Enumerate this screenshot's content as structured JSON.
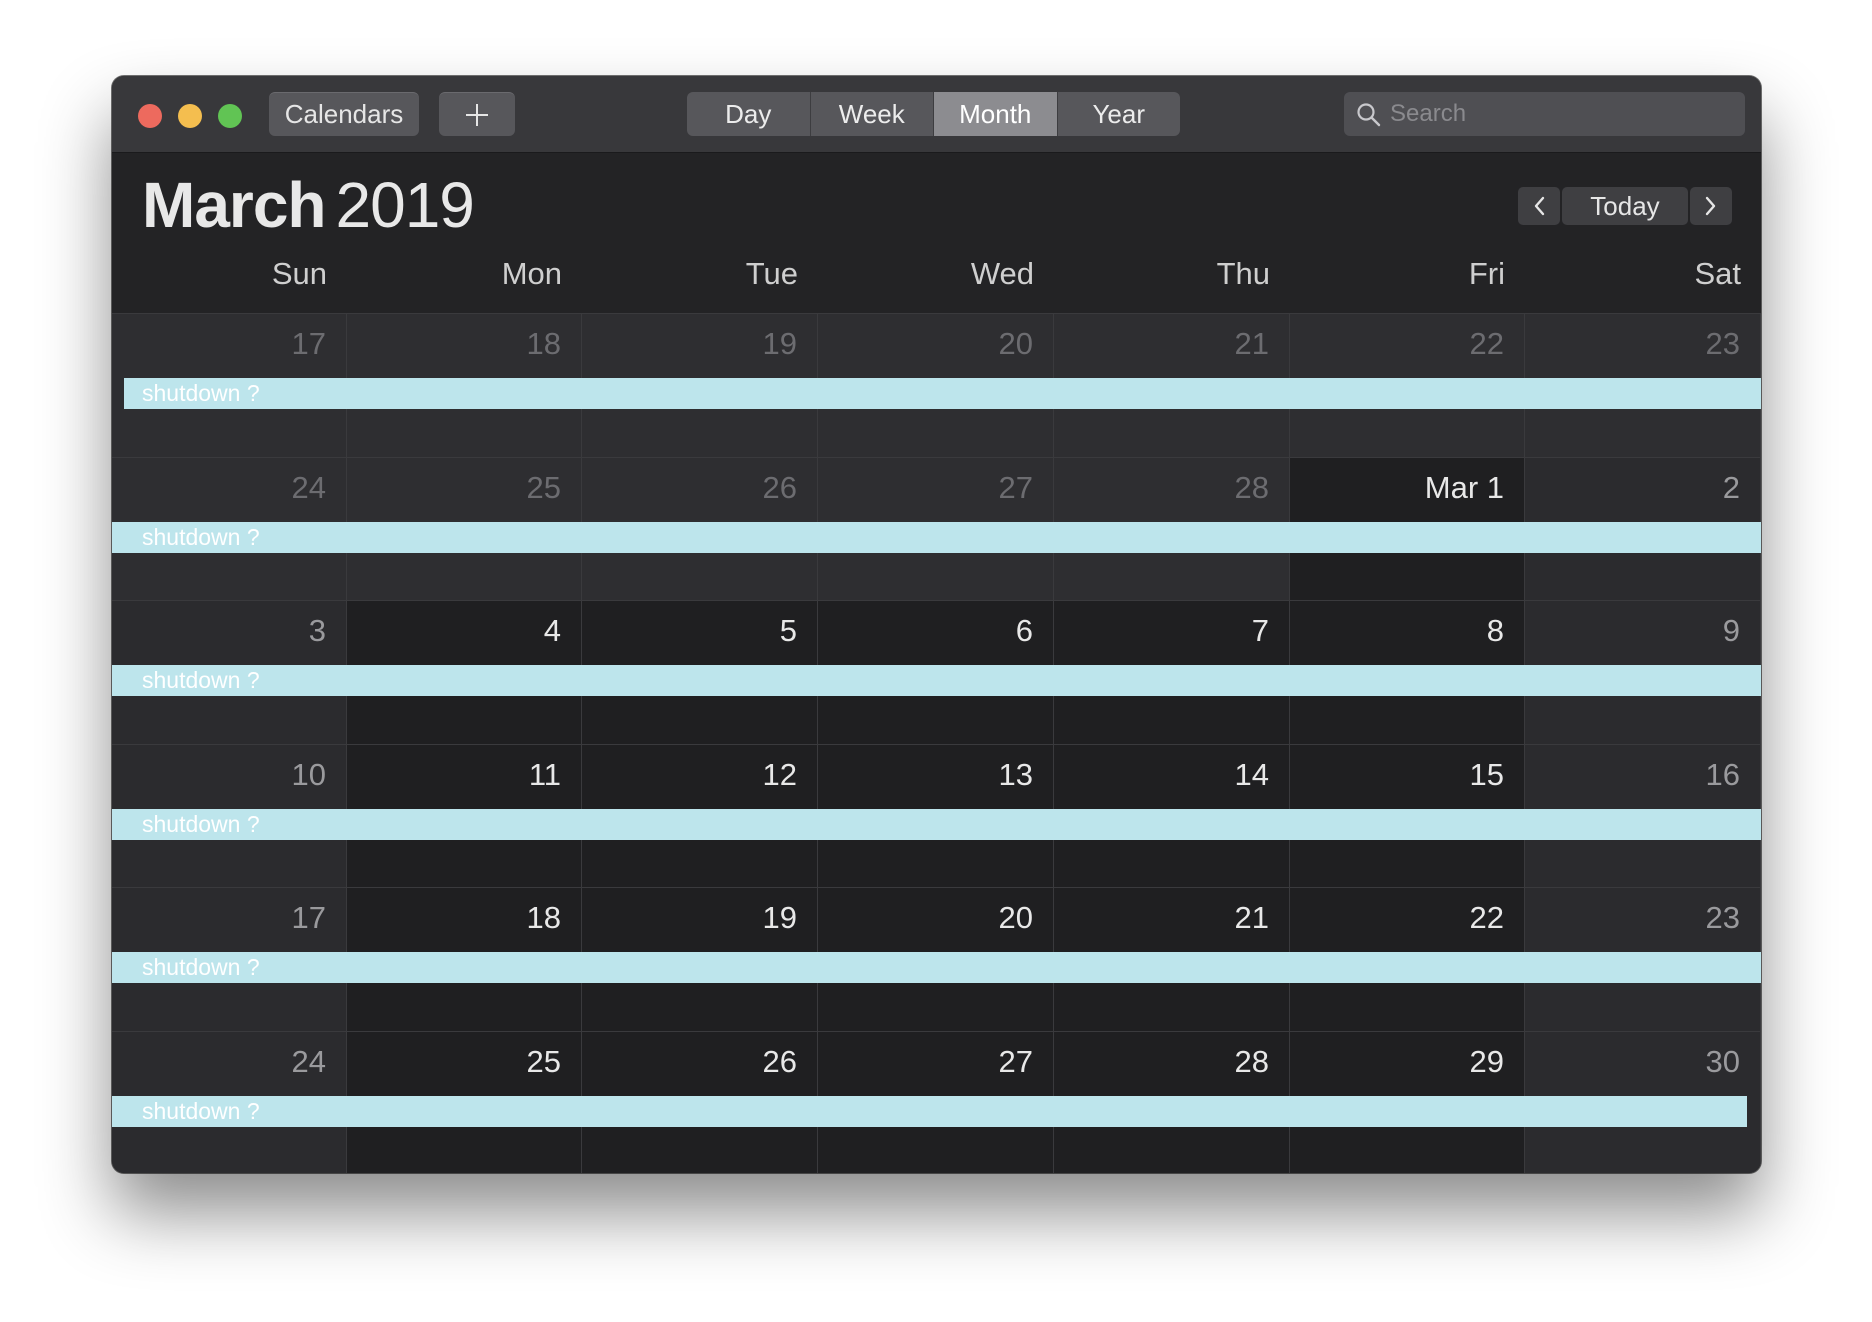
{
  "toolbar": {
    "calendars_label": "Calendars",
    "add_icon": "plus-icon",
    "views": [
      {
        "label": "Day",
        "active": false
      },
      {
        "label": "Week",
        "active": false
      },
      {
        "label": "Month",
        "active": true
      },
      {
        "label": "Year",
        "active": false
      }
    ],
    "search": {
      "placeholder": "Search",
      "value": "",
      "icon": "search-icon"
    }
  },
  "header": {
    "month": "March",
    "year": "2019",
    "today_label": "Today",
    "prev_icon": "chevron-left-icon",
    "next_icon": "chevron-right-icon"
  },
  "weekdays": [
    "Sun",
    "Mon",
    "Tue",
    "Wed",
    "Thu",
    "Fri",
    "Sat"
  ],
  "weeks": [
    {
      "days": [
        "17",
        "18",
        "19",
        "20",
        "21",
        "22",
        "23"
      ],
      "kind": [
        "prev",
        "prev",
        "prev",
        "prev",
        "prev",
        "prev",
        "prev"
      ],
      "event": "shutdown ?"
    },
    {
      "days": [
        "24",
        "25",
        "26",
        "27",
        "28",
        "Mar 1",
        "2"
      ],
      "kind": [
        "prev",
        "prev",
        "prev",
        "prev",
        "prev",
        "cur",
        "we"
      ],
      "event": "shutdown ?"
    },
    {
      "days": [
        "3",
        "4",
        "5",
        "6",
        "7",
        "8",
        "9"
      ],
      "kind": [
        "we",
        "cur",
        "cur",
        "cur",
        "cur",
        "cur",
        "we"
      ],
      "event": "shutdown ?"
    },
    {
      "days": [
        "10",
        "11",
        "12",
        "13",
        "14",
        "15",
        "16"
      ],
      "kind": [
        "we",
        "cur",
        "cur",
        "cur",
        "cur",
        "cur",
        "we"
      ],
      "event": "shutdown ?"
    },
    {
      "days": [
        "17",
        "18",
        "19",
        "20",
        "21",
        "22",
        "23"
      ],
      "kind": [
        "we",
        "cur",
        "cur",
        "cur",
        "cur",
        "cur",
        "we"
      ],
      "event": "shutdown ?"
    },
    {
      "days": [
        "24",
        "25",
        "26",
        "27",
        "28",
        "29",
        "30"
      ],
      "kind": [
        "we",
        "cur",
        "cur",
        "cur",
        "cur",
        "cur",
        "we"
      ],
      "event": "shutdown ?"
    }
  ],
  "colors": {
    "event": "#bde5ec",
    "window": "#232325",
    "titlebar": "#38383b",
    "close": "#ed6a5e",
    "minimize": "#f4be4f",
    "zoom": "#61c454"
  }
}
